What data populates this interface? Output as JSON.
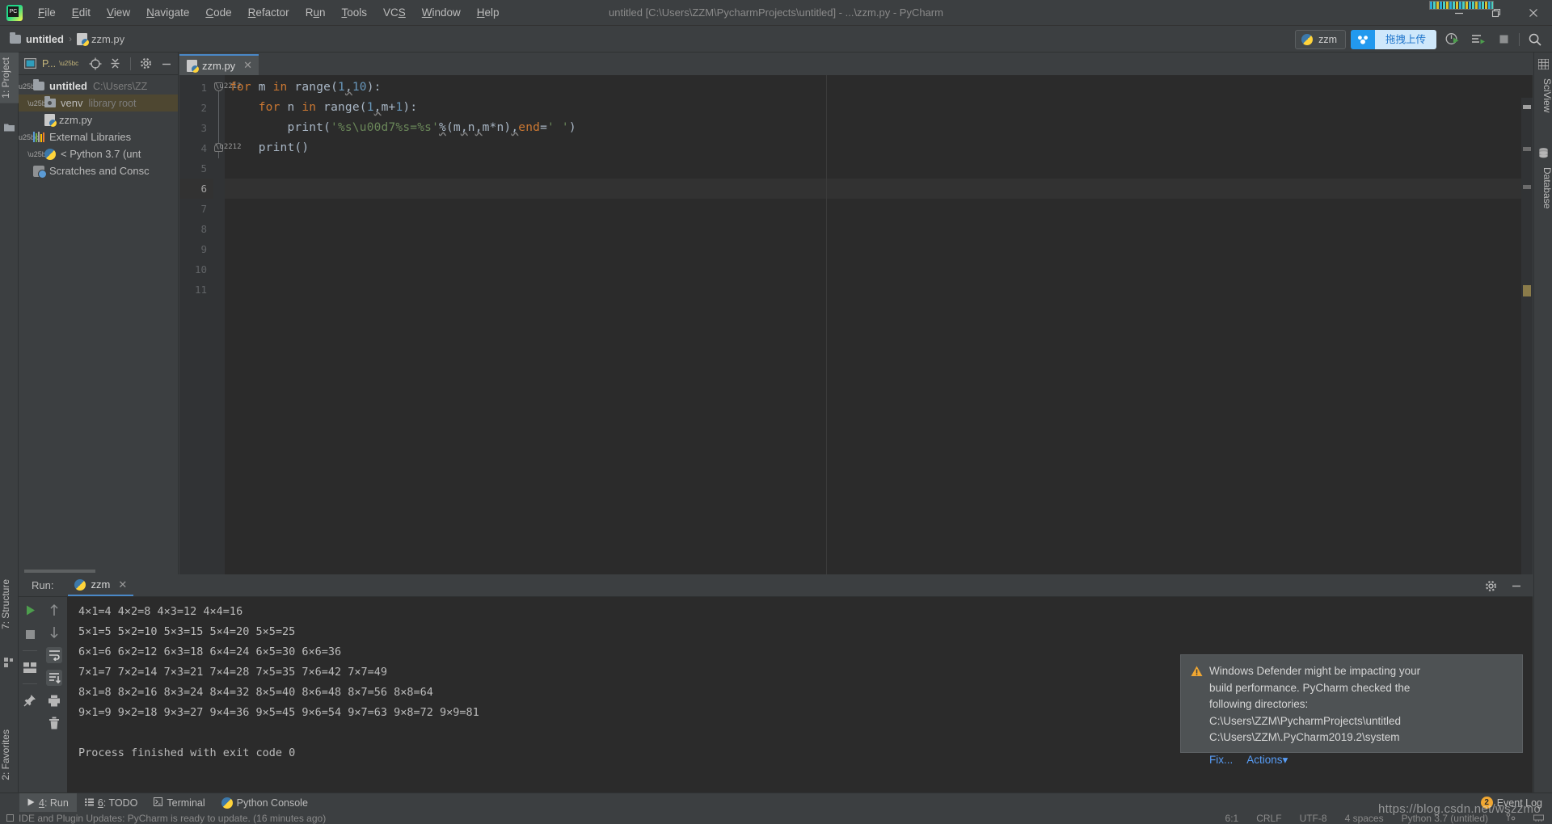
{
  "titlebar": {
    "logo": "pycharm-logo",
    "window_title": "untitled [C:\\Users\\ZZM\\PycharmProjects\\untitled] - ...\\zzm.py - PyCharm",
    "menus": [
      {
        "label": "File",
        "mnemonic": "F"
      },
      {
        "label": "Edit",
        "mnemonic": "E"
      },
      {
        "label": "View",
        "mnemonic": "V"
      },
      {
        "label": "Navigate",
        "mnemonic": "N"
      },
      {
        "label": "Code",
        "mnemonic": "C"
      },
      {
        "label": "Refactor",
        "mnemonic": "R"
      },
      {
        "label": "Run",
        "mnemonic": "u"
      },
      {
        "label": "Tools",
        "mnemonic": "T"
      },
      {
        "label": "VCS",
        "mnemonic": "S"
      },
      {
        "label": "Window",
        "mnemonic": "W"
      },
      {
        "label": "Help",
        "mnemonic": "H"
      }
    ],
    "controls": {
      "minimize": "—",
      "restore": "❐",
      "close": "✕"
    }
  },
  "navbar": {
    "breadcrumb": [
      {
        "label": "untitled",
        "icon": "folder-icon"
      },
      {
        "label": "zzm.py",
        "icon": "python-file-icon"
      }
    ],
    "separator": "›",
    "run_config": {
      "label": "zzm",
      "icon": "python-icon"
    },
    "baidu_upload": {
      "label": "拖拽上传",
      "icon": "baidu-netdisk-icon"
    },
    "icons": [
      {
        "name": "run-with-coverage-icon",
        "glyph": "➀"
      },
      {
        "name": "run-icon",
        "glyph": "▶"
      },
      {
        "name": "stop-icon",
        "glyph": "■"
      },
      {
        "name": "search-everywhere-icon",
        "glyph": "⌕"
      }
    ]
  },
  "left_strip": {
    "project_tab": "1: Project",
    "structure_tab": "7: Structure",
    "favorites_tab": "2: Favorites"
  },
  "right_strip": {
    "sciview_tab": "SciView",
    "database_tab": "Database"
  },
  "project_panel": {
    "title": "P...",
    "header_icons": [
      {
        "name": "project-view-icon"
      },
      {
        "name": "locate-icon"
      },
      {
        "name": "collapse-all-icon"
      },
      {
        "name": "settings-gear-icon"
      },
      {
        "name": "hide-panel-icon"
      }
    ],
    "tree": [
      {
        "name": "untitled",
        "meta": "C:\\Users\\ZZ",
        "arrow": "▼",
        "depth": 0,
        "icon": "folder-icon",
        "bold": true,
        "selected": false
      },
      {
        "name": "venv",
        "meta": "library root",
        "arrow": "▶",
        "depth": 1,
        "icon": "venv-folder-icon",
        "bold": false,
        "selected": true
      },
      {
        "name": "zzm.py",
        "meta": "",
        "arrow": "",
        "depth": 1,
        "icon": "python-file-icon",
        "bold": false,
        "selected": false
      },
      {
        "name": "External Libraries",
        "meta": "",
        "arrow": "▼",
        "depth": 0,
        "icon": "libraries-icon",
        "bold": false,
        "selected": false
      },
      {
        "name": "< Python 3.7 (unt",
        "meta": "",
        "arrow": "▶",
        "depth": 1,
        "icon": "python-icon",
        "bold": false,
        "selected": false
      },
      {
        "name": "Scratches and Consc",
        "meta": "",
        "arrow": "",
        "depth": 0,
        "icon": "scratches-icon",
        "bold": false,
        "selected": false
      }
    ]
  },
  "editor": {
    "tab": {
      "label": "zzm.py",
      "icon": "python-file-icon",
      "close": "✕"
    },
    "line_numbers": [
      "1",
      "2",
      "3",
      "4",
      "5",
      "6",
      "7",
      "8",
      "9",
      "10",
      "11"
    ],
    "current_line": 6,
    "code": [
      {
        "n": 1,
        "indent": 0,
        "tokens": [
          {
            "t": "for",
            "c": "kw"
          },
          {
            "t": " ",
            "c": "id"
          },
          {
            "t": "m",
            "c": "id"
          },
          {
            "t": " ",
            "c": "id"
          },
          {
            "t": "in",
            "c": "kw"
          },
          {
            "t": " ",
            "c": "id"
          },
          {
            "t": "range",
            "c": "id"
          },
          {
            "t": "(",
            "c": "par"
          },
          {
            "t": "1",
            "c": "num"
          },
          {
            "t": ",",
            "c": "wavy"
          },
          {
            "t": "10",
            "c": "num"
          },
          {
            "t": "):",
            "c": "par"
          }
        ]
      },
      {
        "n": 2,
        "indent": 1,
        "tokens": [
          {
            "t": "for",
            "c": "kw"
          },
          {
            "t": " ",
            "c": "id"
          },
          {
            "t": "n",
            "c": "id"
          },
          {
            "t": " ",
            "c": "id"
          },
          {
            "t": "in",
            "c": "kw"
          },
          {
            "t": " ",
            "c": "id"
          },
          {
            "t": "range",
            "c": "id"
          },
          {
            "t": "(",
            "c": "par"
          },
          {
            "t": "1",
            "c": "num"
          },
          {
            "t": ",",
            "c": "wavy"
          },
          {
            "t": "m+1",
            "c": "id"
          },
          {
            "t": "):",
            "c": "par"
          }
        ]
      },
      {
        "n": 3,
        "indent": 2,
        "tokens": [
          {
            "t": "print",
            "c": "id"
          },
          {
            "t": "(",
            "c": "par"
          },
          {
            "t": "'%s×%s=%s'",
            "c": "str"
          },
          {
            "t": "%",
            "c": "wavy"
          },
          {
            "t": "(",
            "c": "par"
          },
          {
            "t": "m",
            "c": "id"
          },
          {
            "t": ",",
            "c": "wavy"
          },
          {
            "t": "n",
            "c": "id"
          },
          {
            "t": ",",
            "c": "wavy"
          },
          {
            "t": "m*n",
            "c": "id"
          },
          {
            "t": ")",
            "c": "par"
          },
          {
            "t": ",",
            "c": "wavy"
          },
          {
            "t": "end",
            "c": "kw"
          },
          {
            "t": "=",
            "c": "par"
          },
          {
            "t": "' '",
            "c": "str"
          },
          {
            "t": ")",
            "c": "par"
          }
        ]
      },
      {
        "n": 4,
        "indent": 1,
        "tokens": [
          {
            "t": "print",
            "c": "id"
          },
          {
            "t": "()",
            "c": "par"
          }
        ]
      }
    ]
  },
  "run_panel": {
    "label": "Run:",
    "tab": {
      "label": "zzm",
      "icon": "python-icon",
      "close": "✕"
    },
    "header_icons": [
      {
        "name": "settings-gear-icon",
        "glyph": "⚙"
      },
      {
        "name": "hide-panel-icon",
        "glyph": "—"
      }
    ],
    "toolbar_left": [
      {
        "name": "rerun-icon",
        "glyph": "▶"
      },
      {
        "name": "stop-icon",
        "glyph": "■"
      },
      {
        "name": "layout-icon",
        "glyph": "▤"
      },
      {
        "name": "pin-tab-icon",
        "glyph": "📌"
      }
    ],
    "toolbar_second": [
      {
        "name": "up-arrow-icon",
        "glyph": "↑"
      },
      {
        "name": "down-arrow-icon",
        "glyph": "↓"
      },
      {
        "name": "soft-wrap-icon",
        "glyph": "↩"
      },
      {
        "name": "scroll-to-end-icon",
        "glyph": "⤓"
      },
      {
        "name": "print-icon",
        "glyph": "⎙"
      },
      {
        "name": "clear-all-icon",
        "glyph": "🗑"
      }
    ],
    "console_output": [
      "4×1=4 4×2=8 4×3=12 4×4=16",
      "5×1=5 5×2=10 5×3=15 5×4=20 5×5=25",
      "6×1=6 6×2=12 6×3=18 6×4=24 6×5=30 6×6=36",
      "7×1=7 7×2=14 7×3=21 7×4=28 7×5=35 7×6=42 7×7=49",
      "8×1=8 8×2=16 8×3=24 8×4=32 8×5=40 8×6=48 8×7=56 8×8=64",
      "9×1=9 9×2=18 9×3=27 9×4=36 9×5=45 9×6=54 9×7=63 9×8=72 9×9=81",
      "",
      "Process finished with exit code 0"
    ]
  },
  "notification": {
    "icon": "warning-icon",
    "message_lines": [
      "Windows Defender might be impacting your",
      "build performance. PyCharm checked the",
      "following directories:",
      "C:\\Users\\ZZM\\PycharmProjects\\untitled",
      "C:\\Users\\ZZM\\.PyCharm2019.2\\system"
    ],
    "links": [
      {
        "label": "Fix...",
        "name": "fix-link"
      },
      {
        "label": "Actions",
        "name": "actions-link",
        "caret": "▾"
      }
    ]
  },
  "bottom_tabs": [
    {
      "label": "4: Run",
      "mnemonic": "4",
      "rest": ": Run",
      "icon": "run-icon",
      "selected": true
    },
    {
      "label": "6: TODO",
      "mnemonic": "6",
      "rest": ": TODO",
      "icon": "todo-icon",
      "selected": false
    },
    {
      "label": "Terminal",
      "mnemonic": "",
      "rest": "Terminal",
      "icon": "terminal-icon",
      "selected": false
    },
    {
      "label": "Python Console",
      "mnemonic": "",
      "rest": "Python Console",
      "icon": "python-icon",
      "selected": false
    }
  ],
  "statusbar": {
    "message": "IDE and Plugin Updates: PyCharm is ready to update. (16 minutes ago)",
    "position": "6:1",
    "line_separator": "CRLF",
    "encoding": "UTF-8",
    "indent": "4 spaces",
    "interpreter": "Python 3.7 (untitled)",
    "event_log": "Event Log",
    "event_log_count": "2",
    "icons": [
      {
        "name": "git-branch-icon",
        "glyph": "⑂"
      },
      {
        "name": "memory-indicator-icon",
        "glyph": "▤"
      }
    ]
  },
  "watermark": {
    "text": "https://blog.csdn.net/wszzmo"
  },
  "colors": {
    "panel_bg": "#3c3f41",
    "editor_bg": "#2b2b2b",
    "accent_blue": "#4a88c7",
    "link_blue": "#589df6",
    "keyword_orange": "#cc7832",
    "number_blue": "#6897bb",
    "string_green": "#6a8759",
    "selection_brown": "#4e4731",
    "badge_orange": "#f0a732",
    "baidu_blue": "#2299ee"
  }
}
